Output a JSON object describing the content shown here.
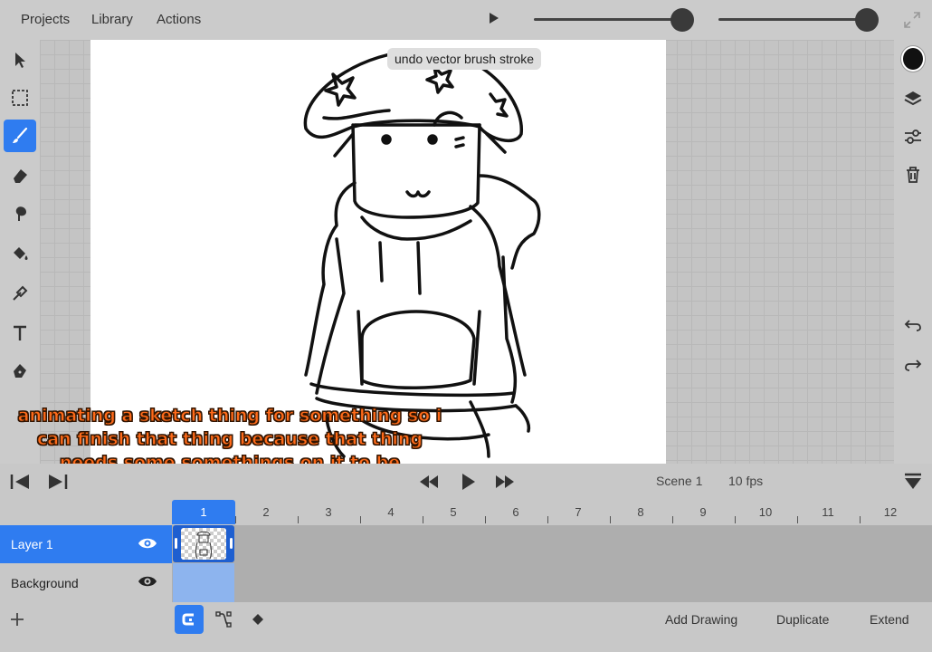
{
  "menu": {
    "projects": "Projects",
    "library": "Library",
    "actions": "Actions"
  },
  "tooltip": "undo vector brush stroke",
  "caption": "animating a sketch thing for something so i can finish that thing because that thing needs some somethings on it to be decorated but i wanted to make my own somethings",
  "playback": {
    "scene": "Scene 1",
    "fps": "10 fps"
  },
  "ruler": {
    "frames": [
      "1",
      "2",
      "3",
      "4",
      "5",
      "6",
      "7",
      "8",
      "9",
      "10",
      "11",
      "12"
    ],
    "active_frame": "1"
  },
  "layers": [
    {
      "name": "Layer 1",
      "selected": true
    },
    {
      "name": "Background",
      "selected": false
    }
  ],
  "bottom": {
    "add_drawing": "Add Drawing",
    "duplicate": "Duplicate",
    "extend": "Extend"
  },
  "colors": {
    "accent": "#2f7cf0",
    "current_color": "#111111"
  },
  "icons": {
    "left": [
      "select-arrow-icon",
      "marquee-select-icon",
      "brush-icon",
      "eraser-icon",
      "smudge-icon",
      "fill-bucket-icon",
      "eyedropper-icon",
      "text-icon",
      "pen-icon"
    ],
    "right": [
      "color-swatch",
      "layers-icon",
      "adjust-sliders-icon",
      "trash-icon",
      "undo-icon",
      "redo-icon"
    ]
  }
}
